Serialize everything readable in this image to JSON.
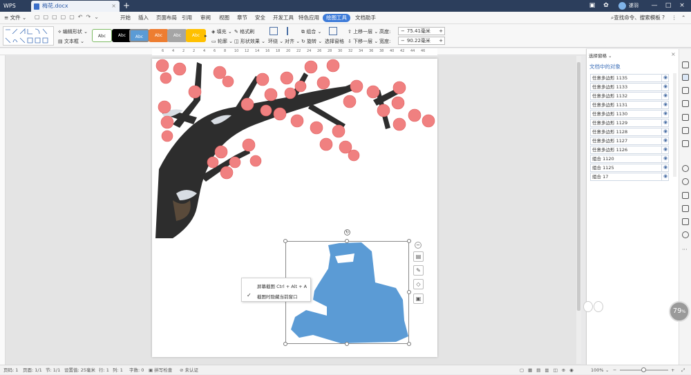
{
  "titlebar": {
    "app": "WPS",
    "doc_tab": "梅花.docx",
    "user": "遂羽"
  },
  "menubar": {
    "file": "文件",
    "items": [
      "开始",
      "插入",
      "页面布局",
      "引用",
      "审阅",
      "视图",
      "章节",
      "安全",
      "开发工具",
      "特色应用",
      "绘图工具",
      "文档助手"
    ],
    "active": "绘图工具",
    "search": "查找命令、搜索模板"
  },
  "ribbon": {
    "edit_shape": "编辑形状",
    "text_box": "文本框",
    "styles": [
      "Abc",
      "Abc",
      "Abc",
      "Abc",
      "Abc",
      "Abc"
    ],
    "fill": "填充",
    "outline": "轮廓",
    "format_brush": "格式刷",
    "shape_effect": "形状效果",
    "wrap": "环绕",
    "align": "对齐",
    "group": "组合",
    "rotate": "旋转",
    "selection_pane": "选择窗格",
    "bring_forward": "上移一层",
    "send_backward": "下移一层",
    "height_label": "高度:",
    "height_value": "75.41毫米",
    "width_label": "宽度:",
    "width_value": "90.22毫米"
  },
  "ruler": {
    "ticks": [
      "6",
      "4",
      "2",
      "2",
      "4",
      "6",
      "8",
      "10",
      "12",
      "14",
      "16",
      "18",
      "20",
      "22",
      "24",
      "26",
      "28",
      "30",
      "32",
      "34",
      "36",
      "38",
      "40",
      "42",
      "44",
      "46"
    ]
  },
  "context_menu": {
    "items": [
      {
        "label": "屏幕截图 Ctrl + Alt + A",
        "checked": false
      },
      {
        "label": "截图时隐藏当前窗口",
        "checked": true
      }
    ]
  },
  "selection_pane": {
    "title": "选择窗格",
    "subtitle": "文档中的对象",
    "objects": [
      "任意多边形 1135",
      "任意多边形 1133",
      "任意多边形 1132",
      "任意多边形 1131",
      "任意多边形 1130",
      "任意多边形 1129",
      "任意多边形 1128",
      "任意多边形 1127",
      "任意多边形 1126",
      "组合 1120",
      "组合 1125",
      "组合 17"
    ]
  },
  "badge": {
    "value": "79",
    "unit": "%"
  },
  "statusbar": {
    "page_num": "页码: 1",
    "pages": "页面: 1/1",
    "section": "节: 1/1",
    "setting": "设置值: 25毫米",
    "row": "行: 1",
    "col": "列: 1",
    "words": "字数: 0",
    "spell": "拼写检查",
    "auth": "未认证",
    "zoom": "100%"
  },
  "colors": {
    "active_tab": "#3d7bd9",
    "shape_fill": "#5b9bd5",
    "blossom": "#f08080",
    "branch": "#2d2d2d"
  }
}
